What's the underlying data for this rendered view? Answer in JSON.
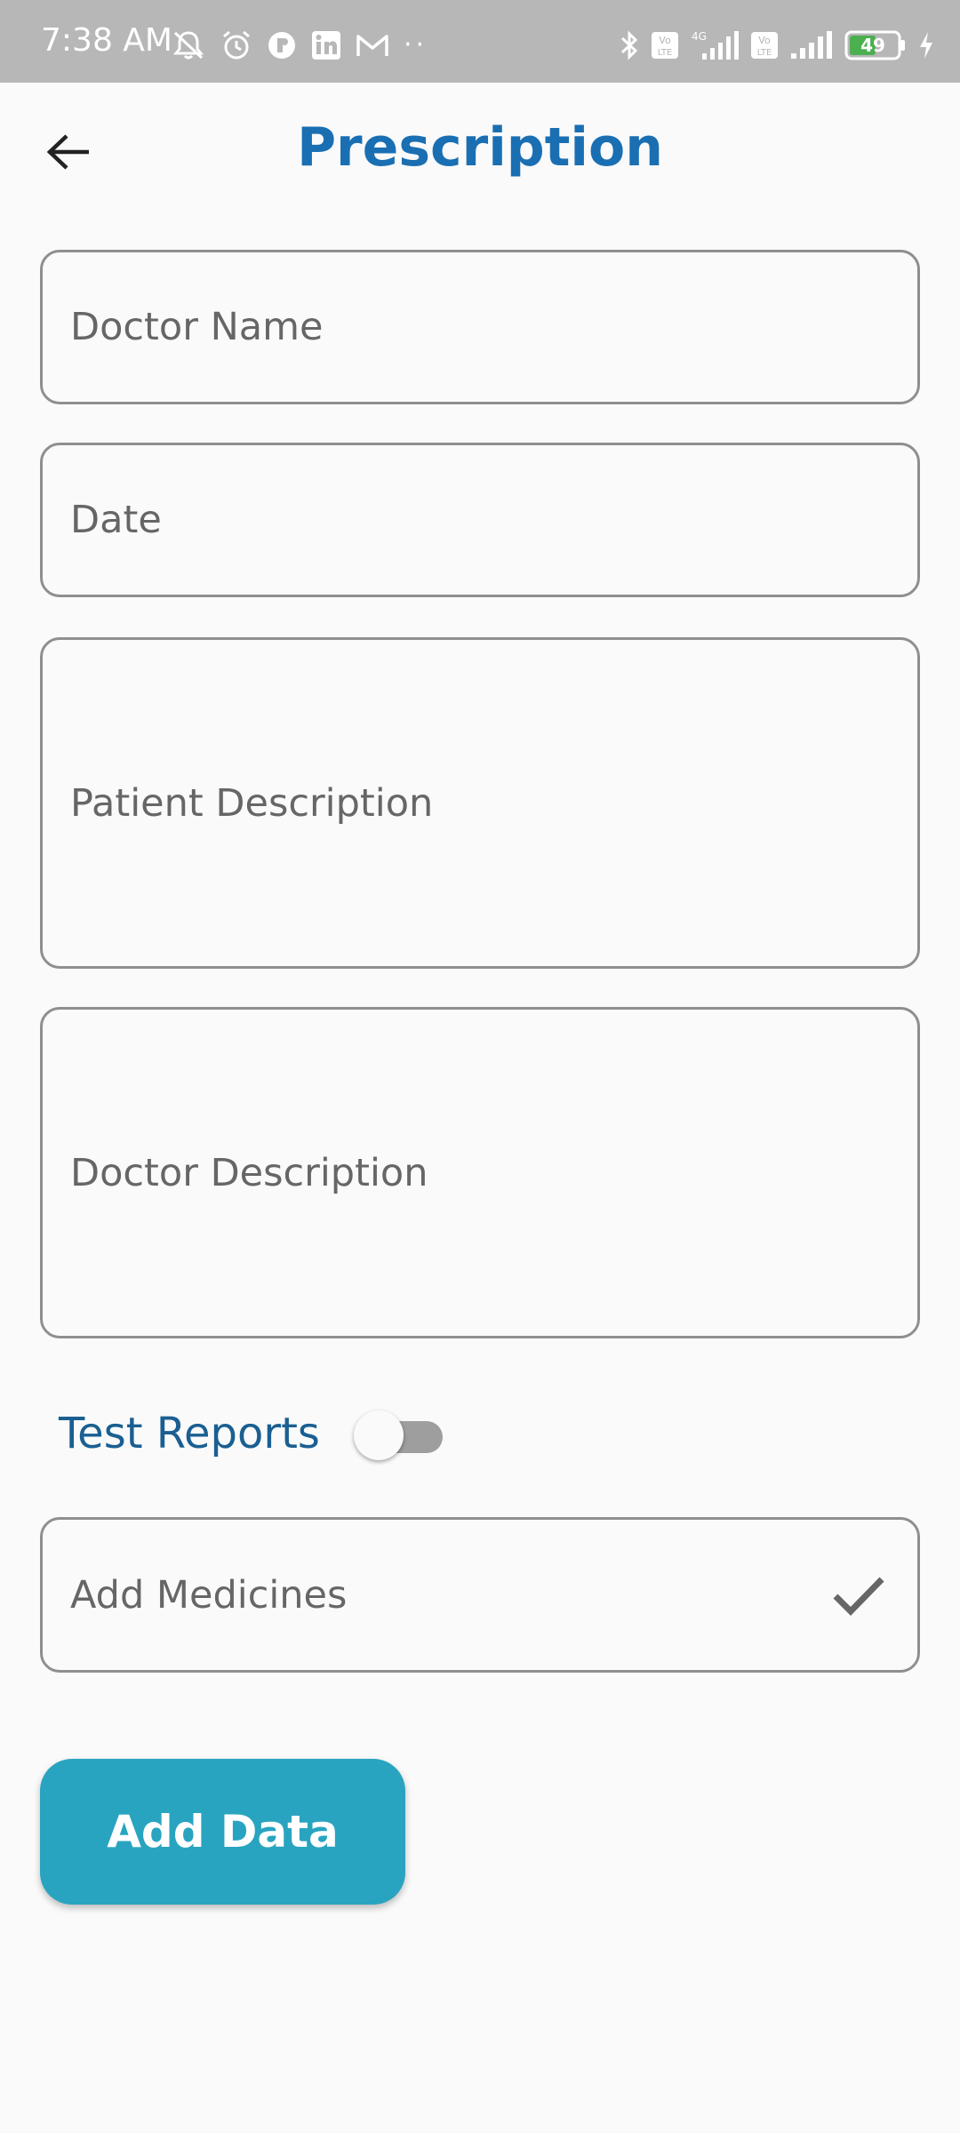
{
  "status_bar": {
    "time": "7:38 AM",
    "battery_level": "49",
    "left_icons": [
      "muted-bell-icon",
      "alarm-icon",
      "app-notification-icon",
      "linkedin-icon",
      "gmail-icon"
    ],
    "more_notifications": "··",
    "right_icons": [
      "bluetooth-icon",
      "volte-icon",
      "signal-4g-icon",
      "volte-icon",
      "signal-icon",
      "battery-icon",
      "charging-icon"
    ],
    "network_label": "4G",
    "volte_label": "Vo LTE"
  },
  "app_bar": {
    "title": "Prescription",
    "back_icon": "arrow-left-icon"
  },
  "form": {
    "doctor_name_label": "Doctor Name",
    "date_label": "Date",
    "patient_description_label": "Patient Description",
    "doctor_description_label": "Doctor Description",
    "test_reports_label": "Test Reports",
    "test_reports_enabled": false,
    "add_medicines_label": "Add Medicines",
    "add_medicines_icon": "check-icon"
  },
  "actions": {
    "add_data_label": "Add Data"
  },
  "colors": {
    "title": "#1a6fb3",
    "toggle_label": "#1a5f92",
    "button": "#29a4c0",
    "status_bar": "#b7b7b7",
    "field_border": "#8f8f8f",
    "background": "#fafafa"
  }
}
